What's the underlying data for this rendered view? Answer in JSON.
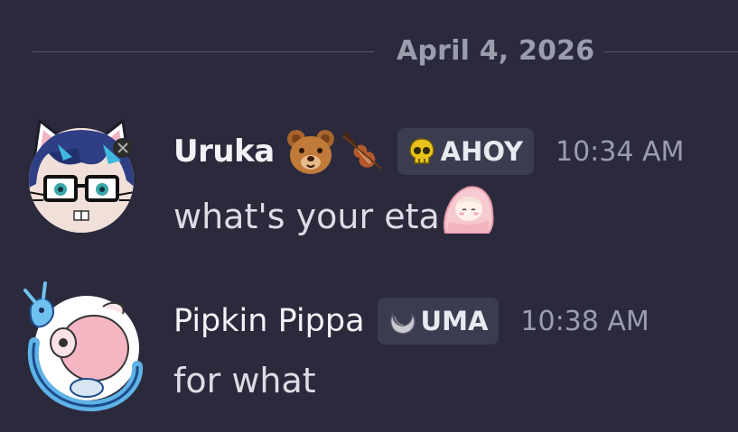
{
  "chat": {
    "date_divider": "April 4, 2026",
    "messages": [
      {
        "username": "Uruka",
        "avatar_icon": "cat-ear-avatar-icon",
        "decoration_emojis": [
          "bear-face-emoji-icon",
          "violin-emoji-icon"
        ],
        "tag": {
          "icon": "skull-icon",
          "label": "AHOY"
        },
        "timestamp": "10:34 AM",
        "text": "what's your eta",
        "sticker": "blanket-girl-sticker-icon"
      },
      {
        "username": "Pipkin Pippa",
        "avatar_icon": "pink-creature-avatar-icon",
        "tag": {
          "icon": "crescent-ring-icon",
          "label": "UMA"
        },
        "timestamp": "10:38 AM",
        "text": "for what"
      }
    ]
  },
  "colors": {
    "background": "#2b2a3d",
    "tag_background": "#3b3c50",
    "muted_text": "#9b9dad",
    "username": "#f2f3f7",
    "message_text": "#dcdde6"
  }
}
